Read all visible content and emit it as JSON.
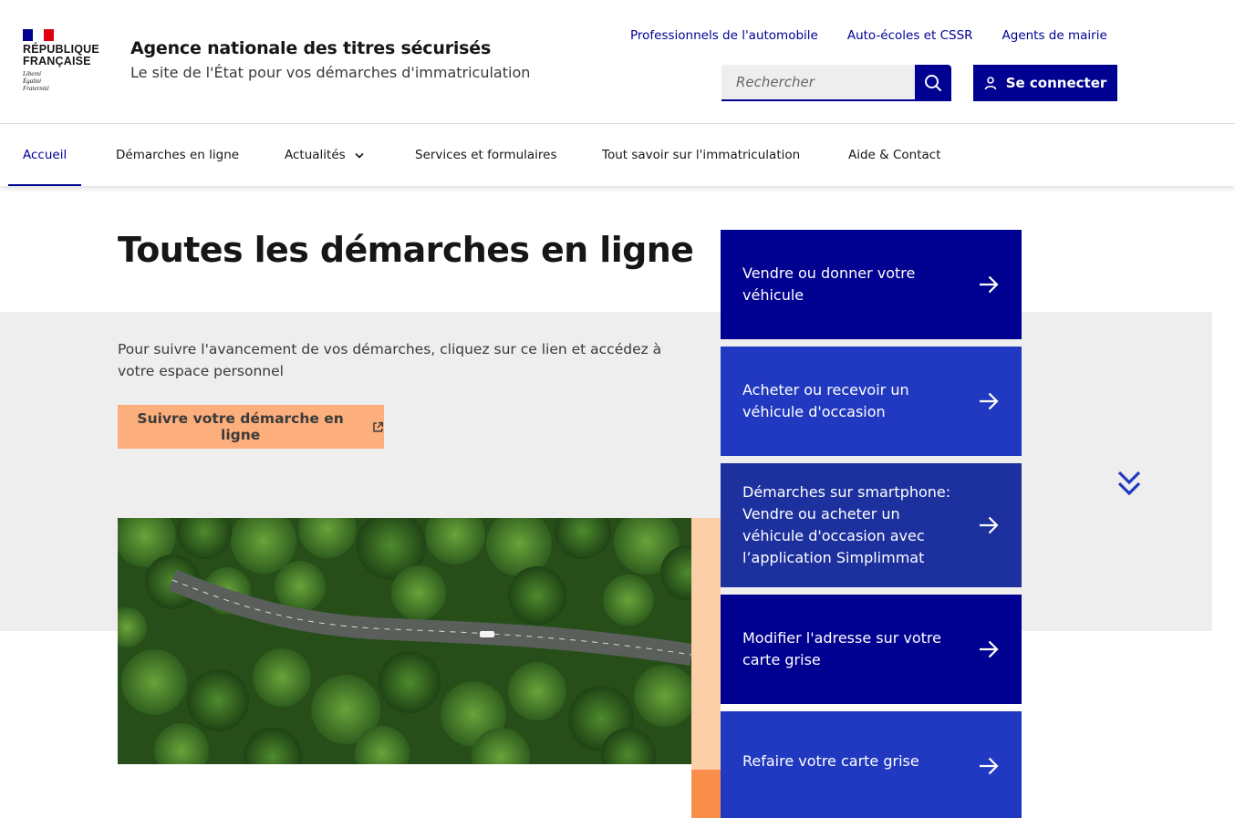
{
  "header": {
    "republic_line1": "RÉPUBLIQUE",
    "republic_line2": "FRANÇAISE",
    "motto_1": "Liberté",
    "motto_2": "Égalité",
    "motto_3": "Fraternité",
    "site_title": "Agence nationale des titres sécurisés",
    "site_tagline": "Le site de l'État pour vos démarches d'immatriculation",
    "top_links": [
      "Professionnels de l'automobile",
      "Auto-écoles et CSSR",
      "Agents de mairie"
    ],
    "search_placeholder": "Rechercher",
    "login_label": "Se connecter"
  },
  "nav": {
    "items": [
      "Accueil",
      "Démarches en ligne",
      "Actualités",
      "Services et formulaires",
      "Tout savoir sur l'immatriculation",
      "Aide & Contact"
    ],
    "active": "Accueil"
  },
  "main": {
    "title": "Toutes les démarches en ligne",
    "intro": "Pour suivre l'avancement de vos démarches, cliquez sur ce lien et accédez à votre espace personnel",
    "cta_label": "Suivre votre démarche en ligne"
  },
  "cards": [
    {
      "label": "Vendre ou donner votre véhicule",
      "color": "#000091"
    },
    {
      "label": "Acheter ou recevoir un véhicule d'occasion",
      "color": "#2139c0"
    },
    {
      "label": "Démarches sur smartphone: Vendre ou acheter un véhicule d'occasion avec l’application Simplimmat",
      "color": "#1c309e"
    },
    {
      "label": "Modifier l'adresse sur votre carte grise",
      "color": "#000091"
    },
    {
      "label": "Refaire votre carte grise",
      "color": "#2139c0"
    }
  ],
  "colors": {
    "primary": "#000091",
    "cta": "#fcaf7c",
    "band": "#eeeeee",
    "peach": "#fdcfa8",
    "orange": "#f98e4a"
  }
}
